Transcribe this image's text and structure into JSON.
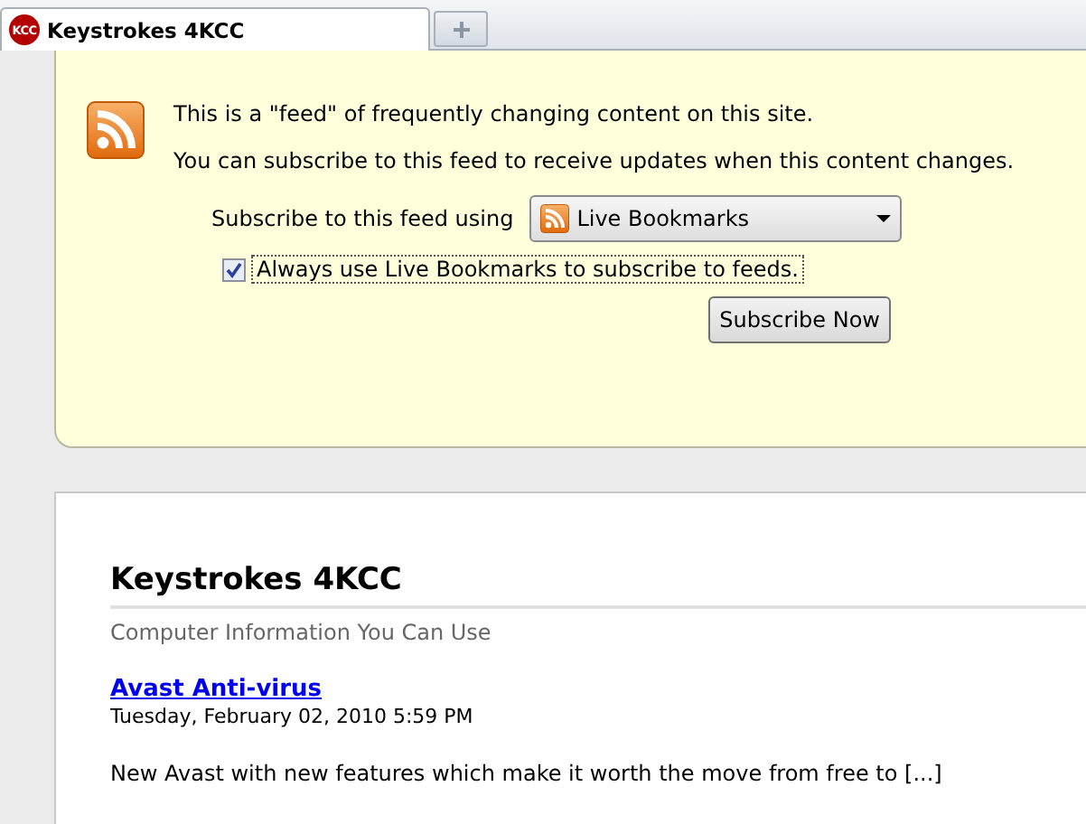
{
  "tabs": [
    {
      "favicon_text": "KCC",
      "label": "Keystrokes 4KCC",
      "selected": true
    }
  ],
  "feed_panel": {
    "intro": "This is a \"feed\" of frequently changing content on this site.",
    "info": "You can subscribe to this feed to receive updates when this content changes.",
    "subscribe_label": "Subscribe to this feed using",
    "reader": "Live Bookmarks",
    "always_use": {
      "label": "Always use Live Bookmarks to subscribe to feeds.",
      "checked": true
    },
    "button": "Subscribe Now"
  },
  "content": {
    "title": "Keystrokes 4KCC",
    "subtitle": "Computer Information You Can Use",
    "entries": [
      {
        "title": "Avast Anti-virus",
        "date": "Tuesday, February 02, 2010 5:59 PM",
        "summary": "New Avast with new features which make it worth the move from free to [...]"
      }
    ]
  }
}
